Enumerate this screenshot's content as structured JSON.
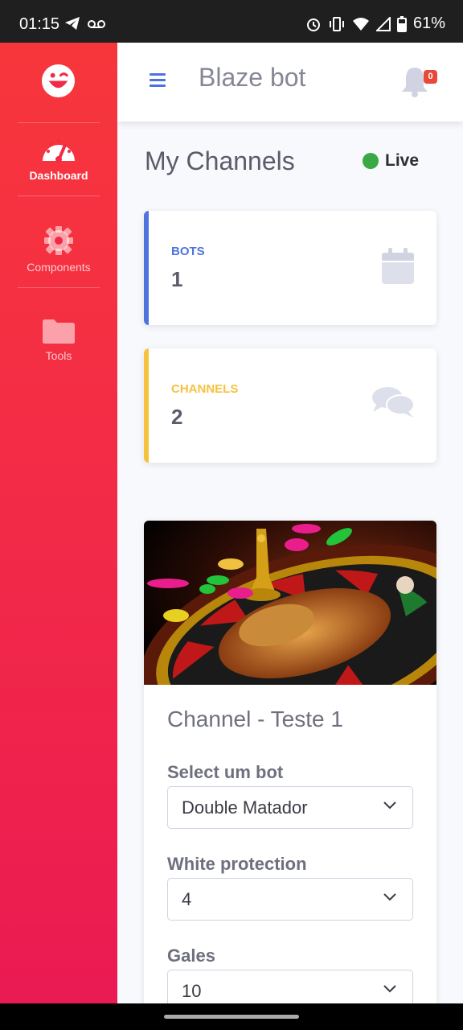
{
  "status_bar": {
    "time": "01:15",
    "battery": "61%"
  },
  "sidebar": {
    "items": [
      {
        "label": "Dashboard",
        "icon": "tachometer-icon",
        "active": true
      },
      {
        "label": "Components",
        "icon": "gear-icon",
        "active": false
      },
      {
        "label": "Tools",
        "icon": "folder-icon",
        "active": false
      }
    ]
  },
  "topbar": {
    "title": "Blaze bot",
    "notification_count": "0"
  },
  "page": {
    "heading": "My Channels",
    "status": "Live"
  },
  "stats": [
    {
      "label": "BOTS",
      "value": "1",
      "color": "#4e73df",
      "icon": "calendar-icon"
    },
    {
      "label": "CHANNELS",
      "value": "2",
      "color": "#f6c23e",
      "icon": "comments-icon"
    }
  ],
  "channel": {
    "title": "Channel - Teste 1",
    "fields": [
      {
        "label": "Select um bot",
        "value": "Double Matador"
      },
      {
        "label": "White protection",
        "value": "4"
      },
      {
        "label": "Gales",
        "value": "10"
      }
    ]
  },
  "colors": {
    "sidebar_top": "#f7363c",
    "sidebar_bottom": "#ea1a52",
    "primary": "#4e73df",
    "warning": "#f6c23e",
    "live": "#3aa845",
    "badge": "#e74a3b"
  }
}
